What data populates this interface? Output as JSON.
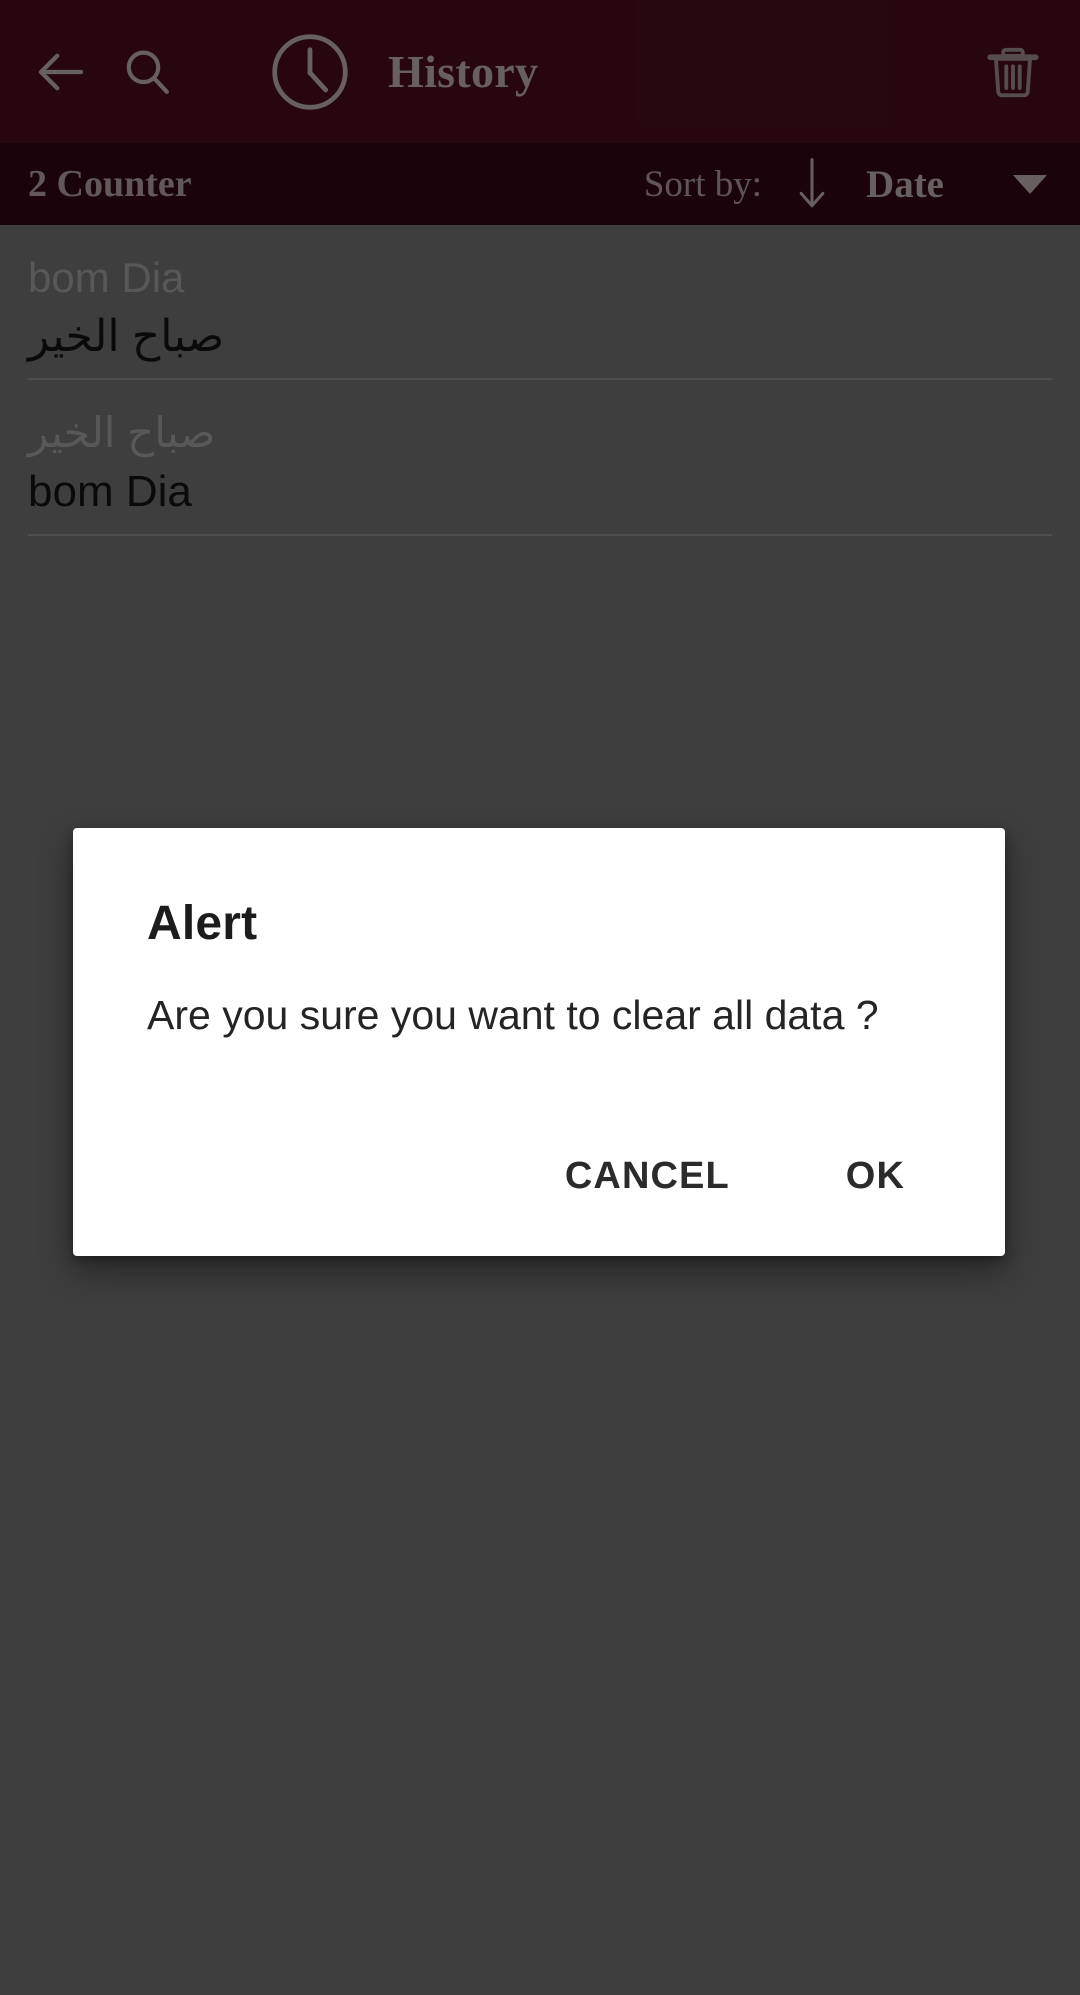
{
  "theme": {
    "appbar_color": "#3f0b1a",
    "subbar_color": "#2c0612",
    "appbar_text_color": "#a9999c",
    "scrim_color": "#646464",
    "dialog_background": "#ffffff",
    "dialog_text_color": "#242424"
  },
  "appbar": {
    "back_icon": "back-arrow-icon",
    "search_icon": "search-icon",
    "clock_icon": "clock-icon",
    "title": "History",
    "delete_icon": "trash-icon"
  },
  "subbar": {
    "counter_label": "2 Counter",
    "sort_by_label": "Sort by:",
    "sort_direction_icon": "arrow-down-icon",
    "sort_value": "Date",
    "dropdown_icon": "caret-down-icon"
  },
  "history": {
    "items": [
      {
        "source_text": "bom Dia",
        "source_dir": "ltr",
        "target_text": "صباح الخير",
        "target_dir": "rtl"
      },
      {
        "source_text": "صباح الخير",
        "source_dir": "rtl",
        "target_text": "bom Dia",
        "target_dir": "ltr"
      }
    ]
  },
  "dialog": {
    "title": "Alert",
    "message": "Are you sure you want to clear all data ?",
    "cancel_label": "CANCEL",
    "ok_label": "OK"
  }
}
